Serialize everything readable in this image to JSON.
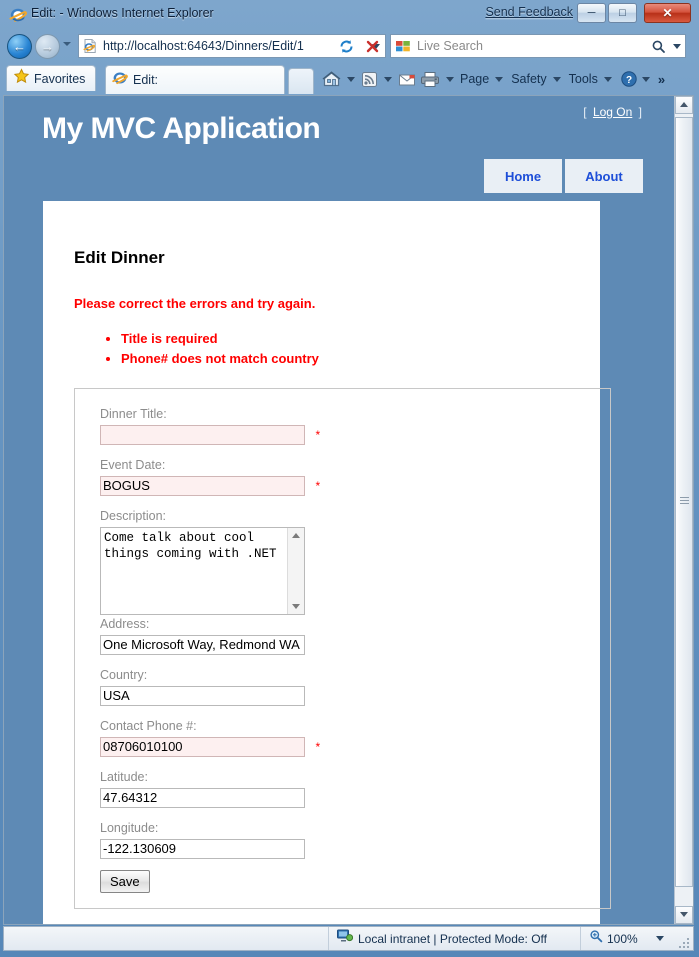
{
  "browser": {
    "window_title": "Edit: - Windows Internet Explorer",
    "send_feedback": "Send Feedback",
    "minimize_glyph": "─",
    "maximize_glyph": "□",
    "close_glyph": "✕",
    "back_glyph": "←",
    "forward_glyph": "→",
    "url": "http://localhost:64643/Dinners/Edit/1",
    "search_placeholder": "Live Search",
    "favorites_label": "Favorites",
    "tab_label": "Edit:",
    "toolbar": {
      "page": "Page",
      "safety": "Safety",
      "tools": "Tools",
      "overflow": "»"
    },
    "status": {
      "zone": "Local intranet | Protected Mode: Off",
      "zoom": "100%"
    }
  },
  "site": {
    "title": "My MVC Application",
    "logon_open_bracket": "[",
    "logon_label": "Log On",
    "logon_close_bracket": "]",
    "menu": [
      {
        "label": "Home"
      },
      {
        "label": "About"
      }
    ]
  },
  "page": {
    "heading": "Edit Dinner",
    "validation_summary": "Please correct the errors and try again.",
    "validation_errors": [
      "Title is required",
      "Phone# does not match country"
    ],
    "required_marker": "*",
    "fields": [
      {
        "name": "dinner-title",
        "label": "Dinner Title:",
        "value": "",
        "type": "text",
        "error": true,
        "required_marker": true
      },
      {
        "name": "event-date",
        "label": "Event Date:",
        "value": "BOGUS",
        "type": "text",
        "error": true,
        "required_marker": true
      },
      {
        "name": "description",
        "label": "Description:",
        "value": "Come talk about cool things coming with .NET",
        "type": "textarea",
        "error": false,
        "required_marker": false
      },
      {
        "name": "address",
        "label": "Address:",
        "value": "One Microsoft Way, Redmond WA",
        "type": "text",
        "error": false,
        "required_marker": false
      },
      {
        "name": "country",
        "label": "Country:",
        "value": "USA",
        "type": "text",
        "error": false,
        "required_marker": false
      },
      {
        "name": "contact-phone",
        "label": "Contact Phone #:",
        "value": "08706010100",
        "type": "text",
        "error": true,
        "required_marker": true
      },
      {
        "name": "latitude",
        "label": "Latitude:",
        "value": "47.64312",
        "type": "text",
        "error": false,
        "required_marker": false
      },
      {
        "name": "longitude",
        "label": "Longitude:",
        "value": "-122.130609",
        "type": "text",
        "error": false,
        "required_marker": false
      }
    ],
    "save_label": "Save"
  },
  "colors": {
    "site_blue": "#5e8ab5",
    "error_red": "#ff0000",
    "link_blue": "#1d4ed8",
    "label_gray": "#8c8c8c",
    "error_field_bg": "#fdf0f0"
  }
}
